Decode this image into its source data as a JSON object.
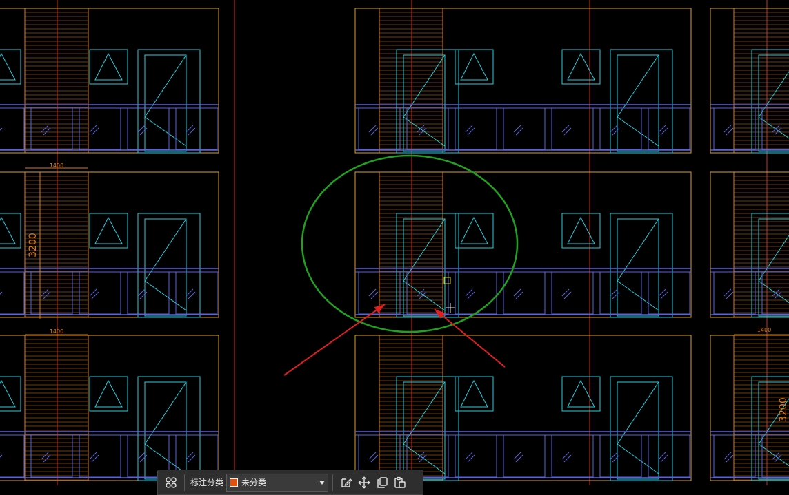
{
  "drawing": {
    "dimension_labels": {
      "width_top_left": "1400",
      "width_mid_left": "1400",
      "height_left": "3200",
      "width_right": "1400",
      "height_right": "3200"
    },
    "colors": {
      "background": "#000000",
      "window": "#22d0e0",
      "railing": "#5a62e0",
      "ac_unit": "#e07a10",
      "wall_outline": "#e0a020",
      "axis_line": "#d03020",
      "marquee_ellipse": "#22a020",
      "arrow": "#e02020",
      "grip": "#e0d020",
      "cursor": "#e6e6e6"
    }
  },
  "toolbar": {
    "grid_icon": "grid-icon",
    "category_label": "标注分类",
    "category_value": "未分类",
    "category_color": "#e05010",
    "edit_icon": "edit-icon",
    "move_icon": "move-icon",
    "copy_icon": "copy-icon",
    "paste_icon": "paste-icon"
  }
}
